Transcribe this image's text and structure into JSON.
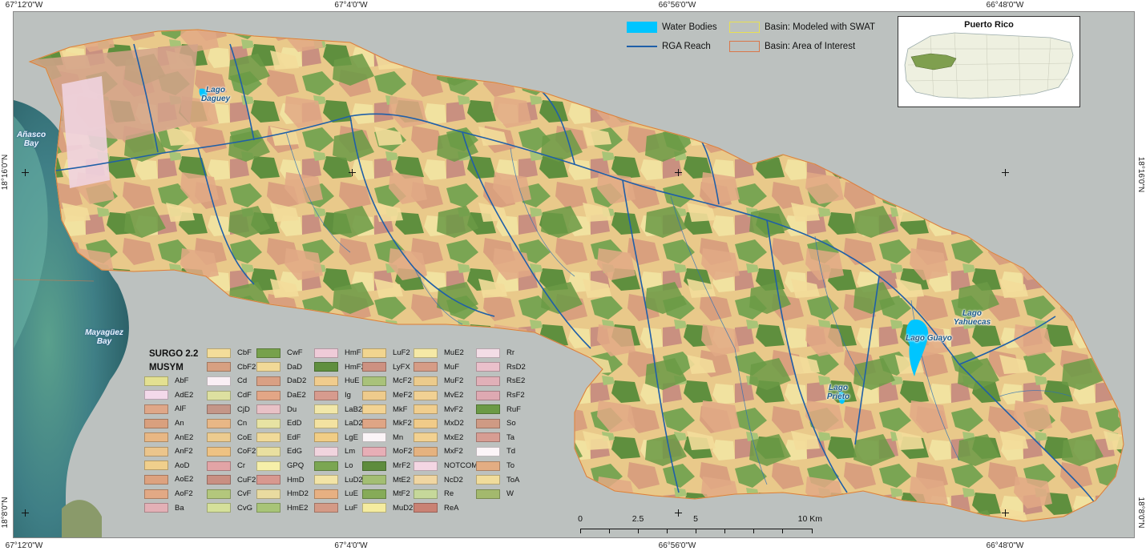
{
  "graticule": {
    "top": [
      "67°12'0\"W",
      "67°4'0\"W",
      "66°56'0\"W",
      "66°48'0\"W"
    ],
    "bottom": [
      "67°12'0\"W",
      "67°4'0\"W",
      "66°56'0\"W",
      "66°48'0\"W"
    ],
    "left": [
      "18°16'0\"N",
      "18°8'0\"N"
    ],
    "right": [
      "18°16'0\"N",
      "18°8'0\"N"
    ]
  },
  "top_legend": {
    "water_bodies": "Water Bodies",
    "rga_reach": "RGA Reach",
    "basin_swat": "Basin: Modeled with SWAT",
    "basin_aoi": "Basin: Area of Interest",
    "colors": {
      "water": "#00c5ff",
      "reach": "#1f5fa8",
      "swat": "#e8e052",
      "aoi": "#d9774a"
    }
  },
  "inset": {
    "title": "Puerto Rico"
  },
  "places": {
    "lago_daguey": "Lago\nDaguey",
    "anasco_bay": "Añasco\nBay",
    "mayaguez_bay": "Mayagüez\nBay",
    "lago_yahuecas": "Lago\nYahuecas",
    "lago_guayo": "Lago Guayo",
    "lago_prieto": "Lago\nPrieto"
  },
  "legend": {
    "title1": "SURGO 2.2",
    "title2": "MUSYM",
    "columns": [
      [
        {
          "code": "AbF",
          "color": "#e3e091"
        },
        {
          "code": "AdE2",
          "color": "#f3d9ea"
        },
        {
          "code": "AlF",
          "color": "#dfa788"
        },
        {
          "code": "An",
          "color": "#d9a07e"
        },
        {
          "code": "AnE2",
          "color": "#e8b784"
        },
        {
          "code": "AnF2",
          "color": "#ebc58c"
        },
        {
          "code": "AoD",
          "color": "#f0cf8c"
        },
        {
          "code": "AoE2",
          "color": "#dda27f"
        },
        {
          "code": "AoF2",
          "color": "#e2a985"
        },
        {
          "code": "Ba",
          "color": "#e3b0b6"
        }
      ],
      [
        {
          "code": "CbF",
          "color": "#f3dd9a"
        },
        {
          "code": "CbF2",
          "color": "#d7a081"
        },
        {
          "code": "Cd",
          "color": "#faeff5"
        },
        {
          "code": "CdF",
          "color": "#dde0a0"
        },
        {
          "code": "CjD",
          "color": "#c49688"
        },
        {
          "code": "Cn",
          "color": "#e8b786"
        },
        {
          "code": "CoE",
          "color": "#eccb8f"
        },
        {
          "code": "CoF2",
          "color": "#eec283"
        },
        {
          "code": "Cr",
          "color": "#e2a4a6"
        },
        {
          "code": "CuF2",
          "color": "#c98f82"
        },
        {
          "code": "CvF",
          "color": "#b3c77c"
        },
        {
          "code": "CvG",
          "color": "#d5e09a"
        }
      ],
      [
        {
          "code": "CwF",
          "color": "#77a14c"
        },
        {
          "code": "DaD",
          "color": "#f1d997"
        },
        {
          "code": "DaD2",
          "color": "#d9a084"
        },
        {
          "code": "DaE2",
          "color": "#e3a686"
        },
        {
          "code": "Du",
          "color": "#e8c1c6"
        },
        {
          "code": "EdD",
          "color": "#e7e3a3"
        },
        {
          "code": "EdF",
          "color": "#f0da99"
        },
        {
          "code": "EdG",
          "color": "#e9dfa0"
        },
        {
          "code": "GPQ",
          "color": "#f6efa9"
        },
        {
          "code": "HmD",
          "color": "#d8988f"
        },
        {
          "code": "HmD2",
          "color": "#e9dba0"
        },
        {
          "code": "HmE2",
          "color": "#a8c477"
        }
      ],
      [
        {
          "code": "HmF",
          "color": "#efcbd8"
        },
        {
          "code": "HmF2",
          "color": "#5f8f3e"
        },
        {
          "code": "HuE",
          "color": "#f0cc8d"
        },
        {
          "code": "Ig",
          "color": "#d79b8e"
        },
        {
          "code": "LaB2",
          "color": "#f1e7a9"
        },
        {
          "code": "LaD2",
          "color": "#f3e2a1"
        },
        {
          "code": "LgE",
          "color": "#f1cd85"
        },
        {
          "code": "Lm",
          "color": "#f1d4de"
        },
        {
          "code": "Lo",
          "color": "#7ba652"
        },
        {
          "code": "LuD2",
          "color": "#f2e4a6"
        },
        {
          "code": "LuE",
          "color": "#e7b082"
        },
        {
          "code": "LuF",
          "color": "#d49a86"
        }
      ],
      [
        {
          "code": "LuF2",
          "color": "#f1d58f"
        },
        {
          "code": "LyFX",
          "color": "#cd9181"
        },
        {
          "code": "McF2",
          "color": "#a9c27a"
        },
        {
          "code": "MeF2",
          "color": "#eecb8c"
        },
        {
          "code": "MkF",
          "color": "#f2d393"
        },
        {
          "code": "MkF2",
          "color": "#dfa585"
        },
        {
          "code": "Mn",
          "color": "#fbf4f7"
        },
        {
          "code": "MoF2",
          "color": "#e7aeb6"
        },
        {
          "code": "MrF2",
          "color": "#5e8c3d"
        },
        {
          "code": "MtE2",
          "color": "#a3be73"
        },
        {
          "code": "MtF2",
          "color": "#86ab58"
        },
        {
          "code": "MuD2",
          "color": "#f5ec9f"
        }
      ],
      [
        {
          "code": "MuE2",
          "color": "#f5e9a6"
        },
        {
          "code": "MuF",
          "color": "#d69c86"
        },
        {
          "code": "MuF2",
          "color": "#eccb8c"
        },
        {
          "code": "MvE2",
          "color": "#f1d193"
        },
        {
          "code": "MvF2",
          "color": "#f0ce8e"
        },
        {
          "code": "MxD2",
          "color": "#f0cb89"
        },
        {
          "code": "MxE2",
          "color": "#f2d191"
        },
        {
          "code": "MxF2",
          "color": "#e5b27f"
        },
        {
          "code": "NOTCOM",
          "color": "#f4d6e3"
        },
        {
          "code": "NcD2",
          "color": "#f0d6a2"
        },
        {
          "code": "Re",
          "color": "#c6d89a"
        },
        {
          "code": "ReA",
          "color": "#c98274"
        }
      ],
      [
        {
          "code": "Rr",
          "color": "#f3dde6"
        },
        {
          "code": "RsD2",
          "color": "#eac0cb"
        },
        {
          "code": "RsE2",
          "color": "#e1b0b8"
        },
        {
          "code": "RsF2",
          "color": "#dea9b2"
        },
        {
          "code": "RuF",
          "color": "#6b9a45"
        },
        {
          "code": "So",
          "color": "#cf9a84"
        },
        {
          "code": "Ta",
          "color": "#d79d93"
        },
        {
          "code": "Td",
          "color": "#fcf5f8"
        },
        {
          "code": "To",
          "color": "#e3ad83"
        },
        {
          "code": "ToA",
          "color": "#f0dc9b"
        },
        {
          "code": "W",
          "color": "#a3b96d"
        }
      ]
    ]
  },
  "scale_bar": {
    "labels": [
      "0",
      "2.5",
      "5",
      "10 Km"
    ]
  }
}
